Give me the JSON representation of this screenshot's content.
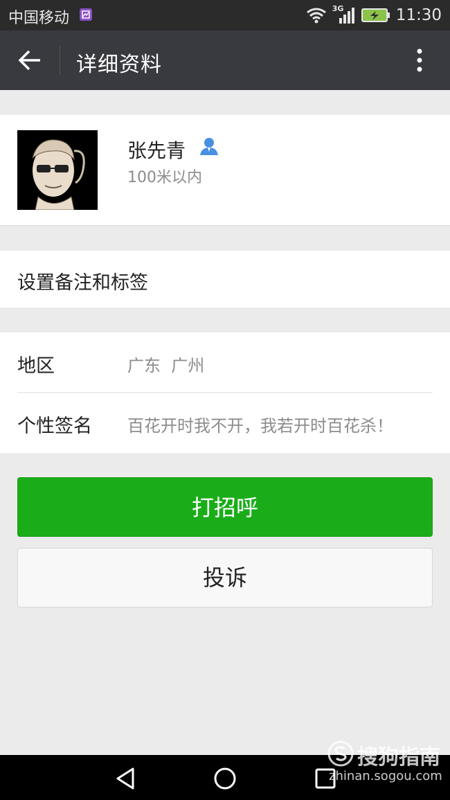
{
  "status_bar": {
    "carrier": "中国移动",
    "network": "3G",
    "time": "11:30",
    "icons": [
      "notification-icon",
      "wifi-icon",
      "signal-icon",
      "battery-charging-icon"
    ]
  },
  "header": {
    "title": "详细资料",
    "back_icon": "arrow-left-icon",
    "more_icon": "more-vertical-icon"
  },
  "profile": {
    "name": "张先青",
    "gender_icon": "male-user-icon",
    "distance": "100米以内"
  },
  "remark": {
    "label": "设置备注和标签"
  },
  "info": [
    {
      "label": "地区",
      "value": "广东  广州"
    },
    {
      "label": "个性签名",
      "value": "百花开时我不开，我若开时百花杀！"
    }
  ],
  "actions": {
    "primary_label": "打招呼",
    "secondary_label": "投诉"
  },
  "watermark": {
    "brand": "搜狗指南",
    "url": "zhinan.sogou.com"
  },
  "colors": {
    "accent": "#1aad19",
    "header_bg": "#393a3f",
    "page_bg": "#ebebeb"
  }
}
